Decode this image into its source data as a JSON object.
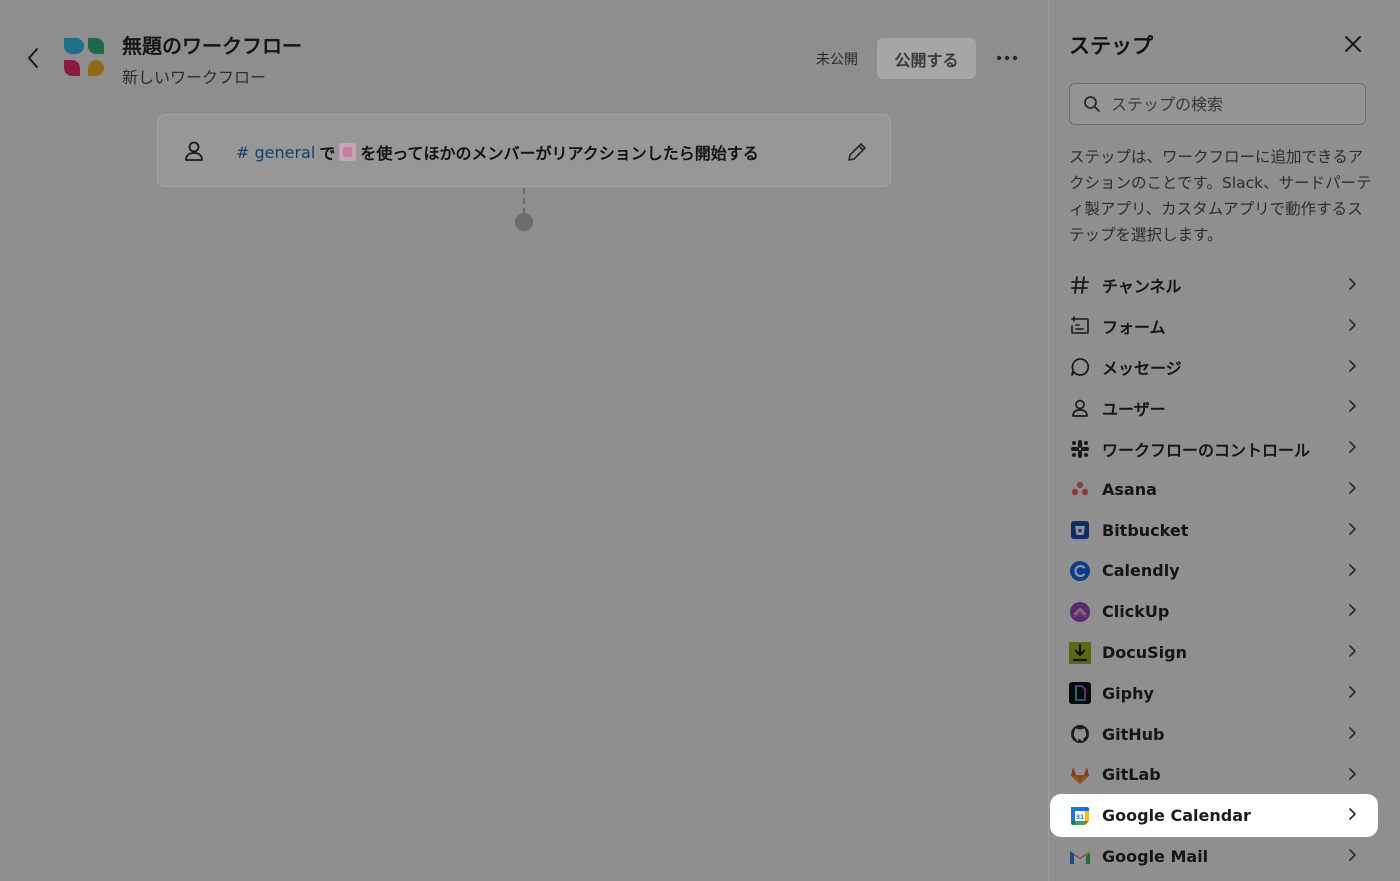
{
  "workflow": {
    "title": "無題のワークフロー",
    "subtitle": "新しいワークフロー",
    "status": "未公開",
    "publish_label": "公開する"
  },
  "trigger": {
    "channel": "# general",
    "text_before": "で",
    "text_after": "を使ってほかのメンバーがリアクションしたら開始する"
  },
  "panel": {
    "title": "ステップ",
    "search_placeholder": "ステップの検索",
    "description": "ステップは、ワークフローに追加できるアクションのことです。Slack、サードパーティ製アプリ、カスタムアプリで動作するステップを選択します。",
    "steps": [
      {
        "label": "チャンネル",
        "icon": "hash-icon"
      },
      {
        "label": "フォーム",
        "icon": "form-icon"
      },
      {
        "label": "メッセージ",
        "icon": "message-icon"
      },
      {
        "label": "ユーザー",
        "icon": "user-icon"
      },
      {
        "label": "ワークフローのコントロール",
        "icon": "slack-icon"
      },
      {
        "label": "Asana",
        "icon": "asana-icon"
      },
      {
        "label": "Bitbucket",
        "icon": "bitbucket-icon"
      },
      {
        "label": "Calendly",
        "icon": "calendly-icon"
      },
      {
        "label": "ClickUp",
        "icon": "clickup-icon"
      },
      {
        "label": "DocuSign",
        "icon": "docusign-icon"
      },
      {
        "label": "Giphy",
        "icon": "giphy-icon"
      },
      {
        "label": "GitHub",
        "icon": "github-icon"
      },
      {
        "label": "GitLab",
        "icon": "gitlab-icon"
      },
      {
        "label": "Google Calendar",
        "icon": "google-calendar-icon",
        "highlighted": true
      },
      {
        "label": "Google Mail",
        "icon": "gmail-icon"
      }
    ]
  },
  "colors": {
    "overlay_bg": "#8e8e8e",
    "highlight_bg": "#ffffff",
    "channel_link": "#10406c"
  }
}
